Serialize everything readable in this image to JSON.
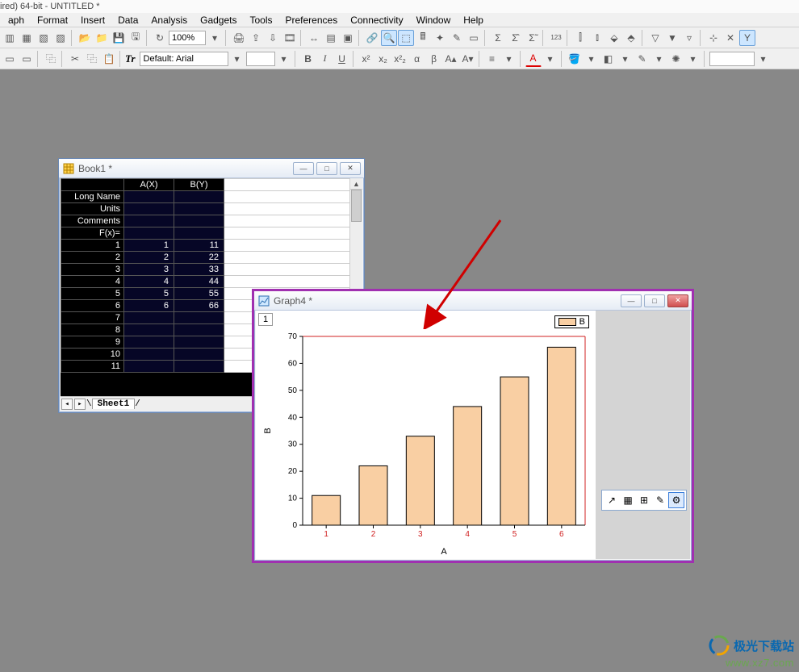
{
  "app_title": "ired) 64-bit - UNTITLED *",
  "menus": [
    "aph",
    "Format",
    "Insert",
    "Data",
    "Analysis",
    "Gadgets",
    "Tools",
    "Preferences",
    "Connectivity",
    "Window",
    "Help"
  ],
  "toolbar": {
    "zoom": "100%"
  },
  "format_bar": {
    "font_label": "Tr",
    "font_name": "Default: Arial",
    "bold": "B",
    "italic": "I",
    "underline": "U"
  },
  "book": {
    "title": "Book1 *",
    "columns": [
      "A(X)",
      "B(Y)"
    ],
    "row_headers": [
      "Long Name",
      "Units",
      "Comments",
      "F(x)="
    ],
    "rows": [
      {
        "n": "1",
        "a": "1",
        "b": "11"
      },
      {
        "n": "2",
        "a": "2",
        "b": "22"
      },
      {
        "n": "3",
        "a": "3",
        "b": "33"
      },
      {
        "n": "4",
        "a": "4",
        "b": "44"
      },
      {
        "n": "5",
        "a": "5",
        "b": "55"
      },
      {
        "n": "6",
        "a": "6",
        "b": "66"
      },
      {
        "n": "7",
        "a": "",
        "b": ""
      },
      {
        "n": "8",
        "a": "",
        "b": ""
      },
      {
        "n": "9",
        "a": "",
        "b": ""
      },
      {
        "n": "10",
        "a": "",
        "b": ""
      },
      {
        "n": "11",
        "a": "",
        "b": ""
      }
    ],
    "sheet_tab": "Sheet1"
  },
  "graph": {
    "title": "Graph4 *",
    "page": "1",
    "legend_label": "B"
  },
  "chart_data": {
    "type": "bar",
    "categories": [
      "1",
      "2",
      "3",
      "4",
      "5",
      "6"
    ],
    "values": [
      11,
      22,
      33,
      44,
      55,
      66
    ],
    "series_name": "B",
    "xlabel": "A",
    "ylabel": "B",
    "ylim": [
      0,
      70
    ],
    "yticks": [
      0,
      10,
      20,
      30,
      40,
      50,
      60,
      70
    ],
    "bar_fill": "#f9cfa3",
    "bar_stroke": "#000000",
    "axis_stroke": "#d02020"
  },
  "watermark": {
    "brand": "极光下载站",
    "url": "www.xz7.com"
  }
}
